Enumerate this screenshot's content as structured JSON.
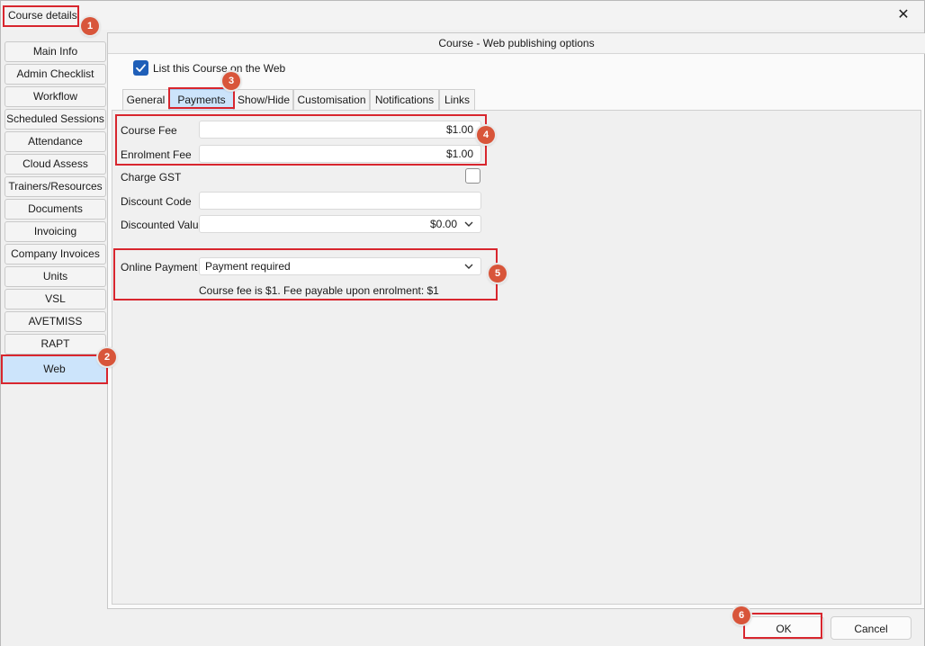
{
  "window": {
    "title": "Course details",
    "close_glyph": "✕"
  },
  "sidebar": {
    "items": [
      {
        "label": "Main Info"
      },
      {
        "label": "Admin Checklist"
      },
      {
        "label": "Workflow"
      },
      {
        "label": "Scheduled Sessions"
      },
      {
        "label": "Attendance"
      },
      {
        "label": "Cloud Assess"
      },
      {
        "label": "Trainers/Resources"
      },
      {
        "label": "Documents"
      },
      {
        "label": "Invoicing"
      },
      {
        "label": "Company Invoices"
      },
      {
        "label": "Units"
      },
      {
        "label": "VSL"
      },
      {
        "label": "AVETMISS"
      },
      {
        "label": "RAPT"
      },
      {
        "label": "Web"
      }
    ],
    "active": "Web"
  },
  "main": {
    "header": "Course - Web publishing options",
    "list_on_web": {
      "label": "List this Course on the Web",
      "checked": true
    },
    "tabs": [
      {
        "label": "General"
      },
      {
        "label": "Payments"
      },
      {
        "label": "Show/Hide"
      },
      {
        "label": "Customisation"
      },
      {
        "label": "Notifications"
      },
      {
        "label": "Links"
      }
    ],
    "active_tab": "Payments",
    "payments": {
      "course_fee": {
        "label": "Course Fee",
        "value": "$1.00"
      },
      "enrolment_fee": {
        "label": "Enrolment Fee",
        "value": "$1.00"
      },
      "charge_gst": {
        "label": "Charge GST",
        "checked": false
      },
      "discount_code": {
        "label": "Discount Code",
        "value": ""
      },
      "discounted_value": {
        "label": "Discounted Value",
        "value": "$0.00"
      },
      "online_payment": {
        "label": "Online Payment",
        "value": "Payment required"
      },
      "online_note": "Course fee is $1. Fee payable upon enrolment: $1"
    }
  },
  "footer": {
    "ok_label": "OK",
    "cancel_label": "Cancel"
  },
  "annotations": [
    "1",
    "2",
    "3",
    "4",
    "5",
    "6"
  ],
  "icons": {
    "close": "close-icon",
    "check": "checkmark-icon",
    "chevron": "chevron-down-icon"
  },
  "colors": {
    "accent": "#1f5fb8",
    "active_tab": "#cce4fb",
    "annotation_red": "#d8262e",
    "badge": "#d8553a"
  }
}
